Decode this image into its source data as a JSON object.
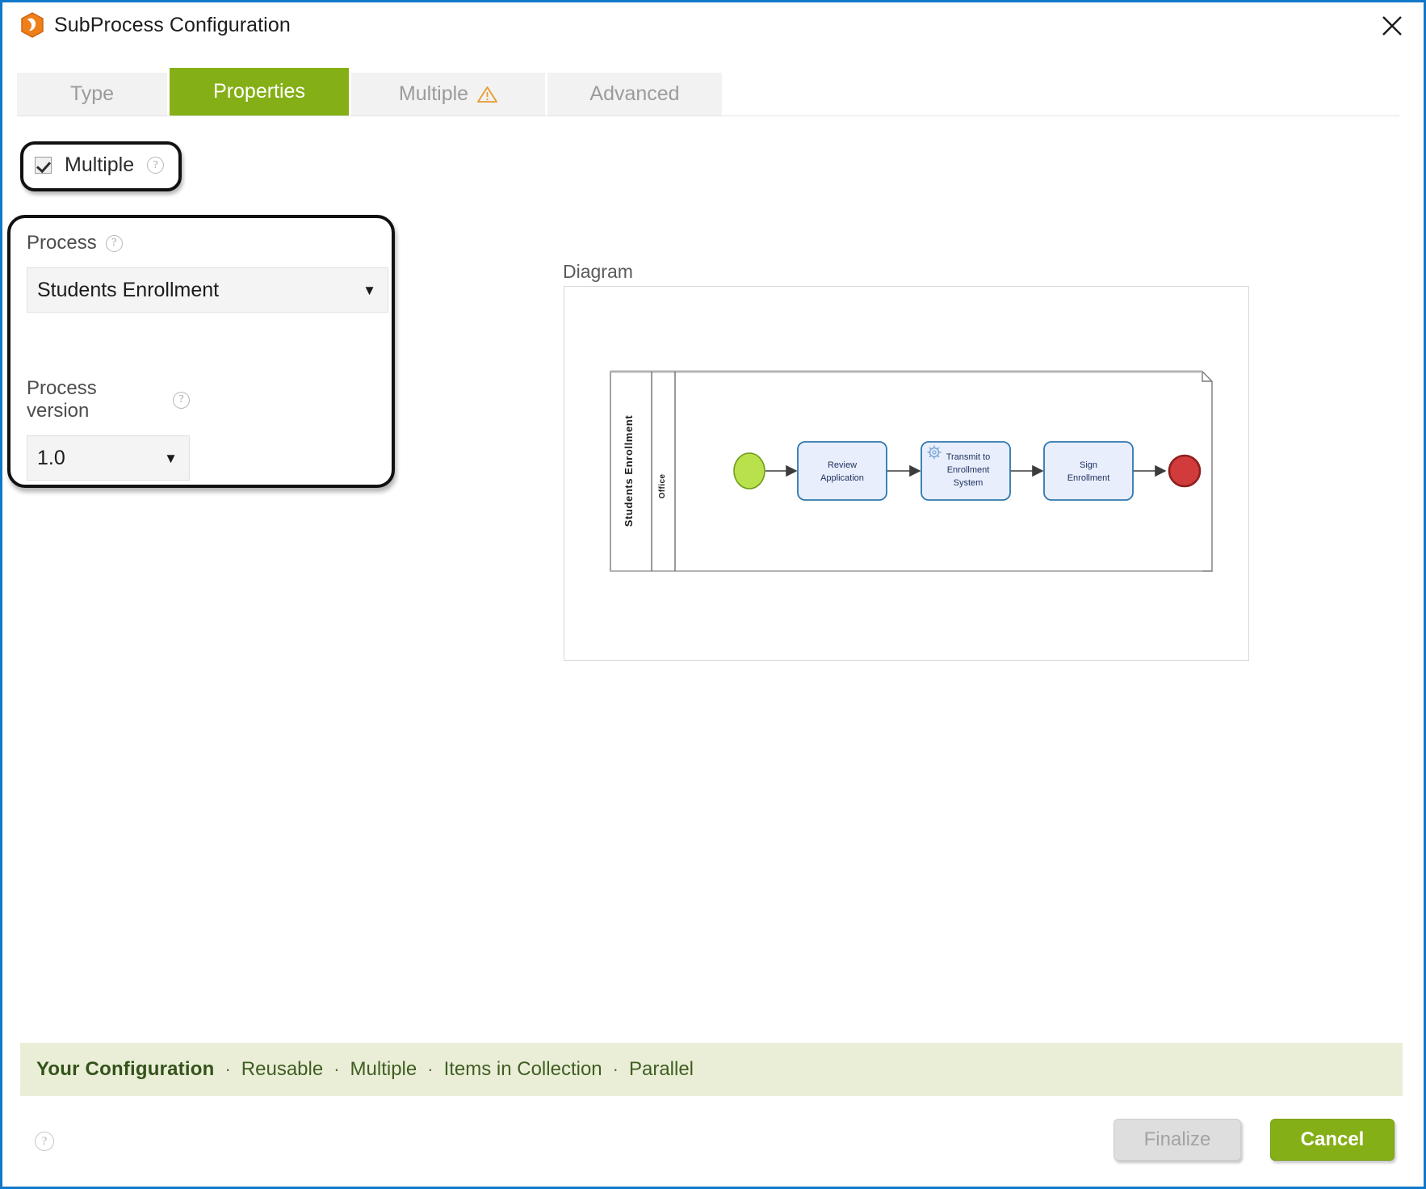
{
  "window": {
    "title": "SubProcess Configuration",
    "app_icon": "hexagon-package-icon",
    "close_icon": "close-icon",
    "accent_border": "#1278c8"
  },
  "tabs": {
    "active_color": "#85af16",
    "items": [
      {
        "label": "Type",
        "active": false,
        "warning": false
      },
      {
        "label": "Properties",
        "active": true,
        "warning": false
      },
      {
        "label": "Multiple",
        "active": false,
        "warning": true,
        "warning_icon": "warning-triangle-icon"
      },
      {
        "label": "Advanced",
        "active": false,
        "warning": false
      }
    ]
  },
  "form": {
    "multiple_checkbox": {
      "label": "Multiple",
      "checked": true,
      "help_icon": "help-icon"
    },
    "process": {
      "label": "Process",
      "help_icon": "help-icon",
      "value": "Students Enrollment",
      "caret": "▼"
    },
    "process_version": {
      "label": "Process version",
      "help_icon": "help-icon",
      "value": "1.0",
      "caret": "▼"
    }
  },
  "diagram": {
    "label": "Diagram",
    "pool_name": "Students Enrollment",
    "lane_name": "Office",
    "nodes": [
      {
        "id": "start",
        "type": "start-event",
        "label": "",
        "color": "#b9e14c"
      },
      {
        "id": "t1",
        "type": "task",
        "label": "Review Application",
        "color": "#e8eefc"
      },
      {
        "id": "t2",
        "type": "service-task",
        "label": "Transmit to Enrollment System",
        "color": "#e8eefc",
        "marker": "gear-icon"
      },
      {
        "id": "t3",
        "type": "task",
        "label": "Sign Enrollment",
        "color": "#e8eefc"
      },
      {
        "id": "end",
        "type": "end-event",
        "label": "",
        "color": "#d23b3b"
      }
    ],
    "flows": [
      {
        "from": "start",
        "to": "t1"
      },
      {
        "from": "t1",
        "to": "t2"
      },
      {
        "from": "t2",
        "to": "t3"
      },
      {
        "from": "t3",
        "to": "end"
      }
    ]
  },
  "summary": {
    "title": "Your Configuration",
    "separator": "·",
    "items": [
      "Reusable",
      "Multiple",
      "Items in Collection",
      "Parallel"
    ]
  },
  "footer": {
    "help_icon": "help-icon",
    "finalize_label": "Finalize",
    "finalize_enabled": false,
    "cancel_label": "Cancel"
  }
}
